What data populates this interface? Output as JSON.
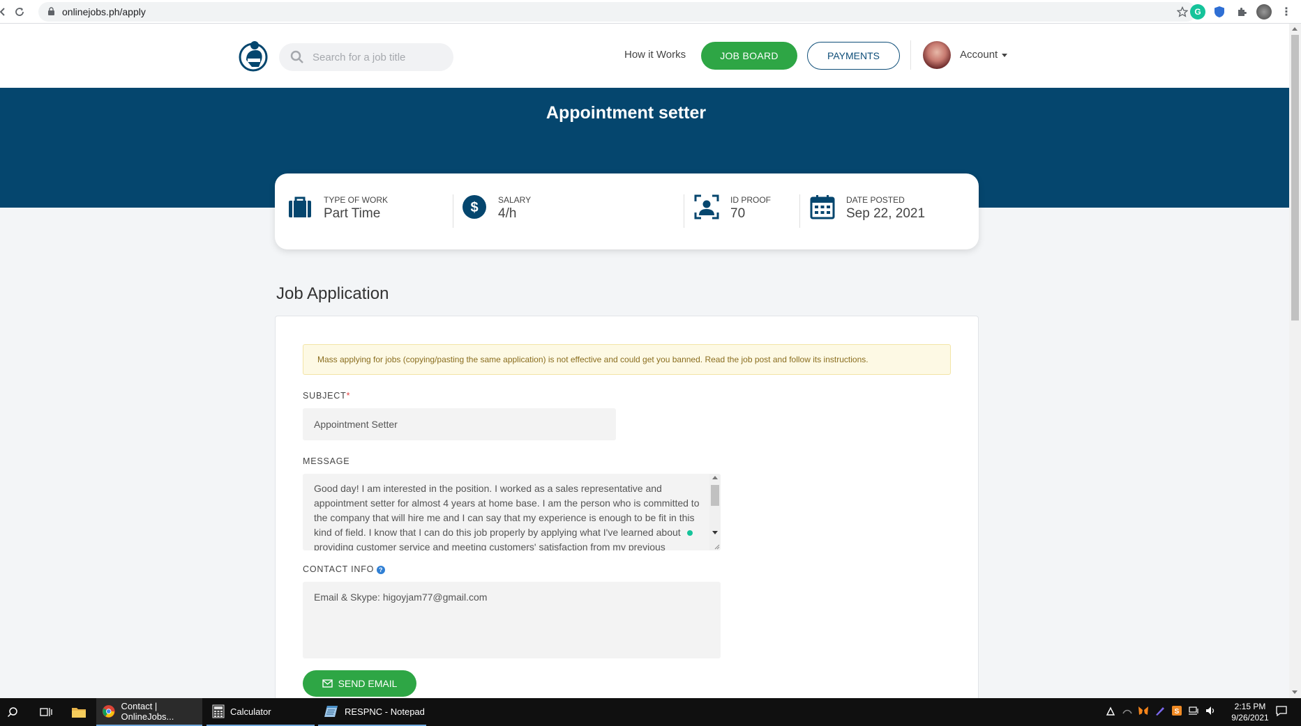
{
  "browser": {
    "url": "onlinejobs.ph/apply"
  },
  "header": {
    "search_placeholder": "Search for a job title",
    "how_it_works": "How it Works",
    "job_board": "JOB BOARD",
    "payments": "PAYMENTS",
    "account": "Account"
  },
  "hero": {
    "title": "Appointment setter"
  },
  "info": {
    "type_of_work_label": "TYPE OF WORK",
    "type_of_work_value": "Part Time",
    "salary_label": "SALARY",
    "salary_value": "4/h",
    "id_proof_label": "ID PROOF",
    "id_proof_value": "70",
    "date_posted_label": "DATE POSTED",
    "date_posted_value": "Sep 22, 2021"
  },
  "application": {
    "title": "Job Application",
    "alert": "Mass applying for jobs (copying/pasting the same application) is not effective and could get you banned. Read the job post and follow its instructions.",
    "subject_label": "SUBJECT",
    "subject_required": "*",
    "subject_value": "Appointment Setter",
    "message_label": "MESSAGE",
    "message_value": "Good day! I am interested in the position. I worked as a sales representative and appointment setter for almost 4 years at home base. I am the person who is committed to the company that will hire me and I can say that my experience is enough to be fit in this kind of field. I know that I can do this job properly by applying what I've learned about providing customer service and meeting customers' satisfaction from my previous",
    "contact_label": "CONTACT INFO",
    "contact_help": "?",
    "contact_value": "Email & Skype: higoyjam77@gmail.com",
    "send_button": "SEND EMAIL"
  },
  "taskbar": {
    "apps": [
      {
        "label": "Contact | OnlineJobs..."
      },
      {
        "label": "Calculator"
      },
      {
        "label": "RESPNC - Notepad"
      }
    ],
    "time": "2:15 PM",
    "date": "9/26/2021"
  },
  "colors": {
    "brand_navy": "#05466e",
    "brand_green": "#2ea645",
    "alert_bg": "#fdf9e4"
  }
}
